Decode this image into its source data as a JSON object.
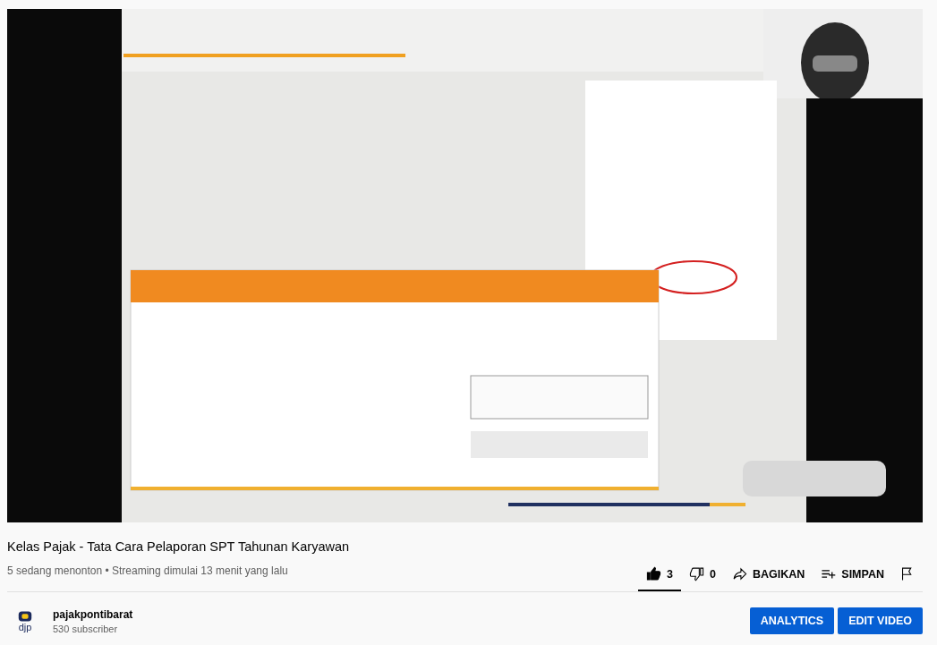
{
  "title": "Kelas Pajak - Tata Cara Pelaporan SPT Tahunan Karyawan",
  "meta": "5 sedang menonton • Streaming dimulai 13 menit yang lalu",
  "actions": [
    {
      "kind": "like",
      "label": "3",
      "selected": true
    },
    {
      "kind": "dislike",
      "label": "0",
      "selected": false
    },
    {
      "kind": "share",
      "label": "BAGIKAN"
    },
    {
      "kind": "save",
      "label": "SIMPAN"
    },
    {
      "kind": "report"
    }
  ],
  "channel": {
    "name": "pajakpontibarat",
    "subscribers": "530 subscriber",
    "avatar_label": "djp"
  },
  "buttons": [
    "ANALYTICS",
    "EDIT VIDEO"
  ]
}
